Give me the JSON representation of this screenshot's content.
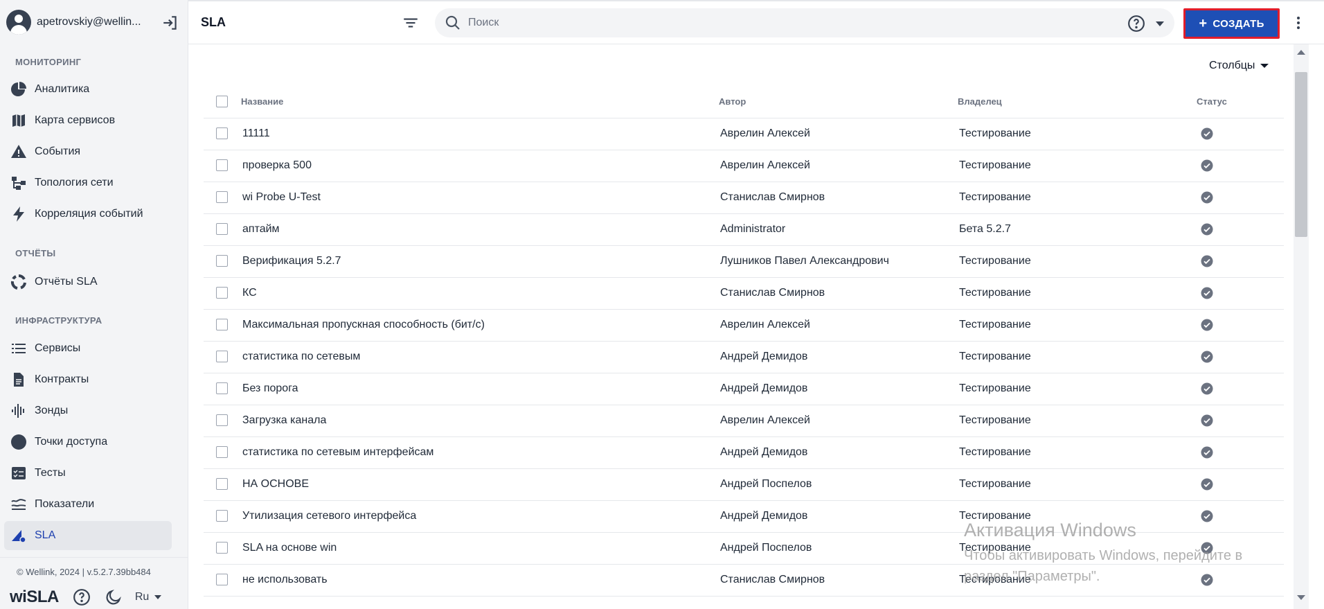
{
  "user": {
    "name": "apetrovskiy@wellin..."
  },
  "sidebar": {
    "sections": [
      {
        "title": "МОНИТОРИНГ"
      },
      {
        "title": "ОТЧЁТЫ"
      },
      {
        "title": "ИНФРАСТРУКТУРА"
      }
    ],
    "items": [
      {
        "label": "Аналитика",
        "icon": "pie-chart-icon"
      },
      {
        "label": "Карта сервисов",
        "icon": "map-icon"
      },
      {
        "label": "События",
        "icon": "warning-icon"
      },
      {
        "label": "Топология сети",
        "icon": "topology-icon"
      },
      {
        "label": "Корреляция событий",
        "icon": "bolt-icon"
      },
      {
        "label": "Отчёты SLA",
        "icon": "report-ring-icon"
      },
      {
        "label": "Сервисы",
        "icon": "list-icon"
      },
      {
        "label": "Контракты",
        "icon": "document-icon"
      },
      {
        "label": "Зонды",
        "icon": "wave-icon"
      },
      {
        "label": "Точки доступа",
        "icon": "circle-icon"
      },
      {
        "label": "Тесты",
        "icon": "checklist-icon"
      },
      {
        "label": "Показатели",
        "icon": "metrics-icon"
      },
      {
        "label": "SLA",
        "icon": "sla-icon",
        "active": true
      }
    ],
    "copyright": "© Wellink, 2024 | v.5.2.7.39bb484",
    "logo": "wiSLA",
    "language": "Ru"
  },
  "header": {
    "title": "SLA",
    "search_placeholder": "Поиск",
    "create_label": "СОЗДАТЬ",
    "create_plus": "+"
  },
  "table": {
    "columns_button": "Столбцы",
    "headers": {
      "name": "Название",
      "author": "Автор",
      "owner": "Владелец",
      "status": "Статус"
    },
    "rows": [
      {
        "name": "11111",
        "author": "Аврелин Алексей",
        "owner": "Тестирование"
      },
      {
        "name": "проверка 500",
        "author": "Аврелин Алексей",
        "owner": "Тестирование"
      },
      {
        "name": "wi Probe U-Test",
        "author": "Станислав Смирнов",
        "owner": "Тестирование"
      },
      {
        "name": "аптайм",
        "author": "Administrator",
        "owner": "Бета 5.2.7"
      },
      {
        "name": "Верификация 5.2.7",
        "author": "Лушников Павел Александрович",
        "owner": "Тестирование"
      },
      {
        "name": "КС",
        "author": "Станислав Смирнов",
        "owner": "Тестирование"
      },
      {
        "name": "Максимальная пропускная способность (бит/с)",
        "author": "Аврелин Алексей",
        "owner": "Тестирование"
      },
      {
        "name": "статистика по сетевым",
        "author": "Андрей Демидов",
        "owner": "Тестирование"
      },
      {
        "name": "Без порога",
        "author": "Андрей Демидов",
        "owner": "Тестирование"
      },
      {
        "name": "Загрузка канала",
        "author": "Аврелин Алексей",
        "owner": "Тестирование"
      },
      {
        "name": "статистика по сетевым интерфейсам",
        "author": "Андрей Демидов",
        "owner": "Тестирование"
      },
      {
        "name": "НА ОСНОВЕ",
        "author": "Андрей Поспелов",
        "owner": "Тестирование"
      },
      {
        "name": "Утилизация сетевого интерфейса",
        "author": "Андрей Демидов",
        "owner": "Тестирование"
      },
      {
        "name": "SLA на основе win",
        "author": "Андрей Поспелов",
        "owner": "Тестирование"
      },
      {
        "name": "не использовать",
        "author": "Станислав Смирнов",
        "owner": "Тестирование"
      }
    ]
  },
  "watermark": {
    "title": "Активация Windows",
    "text": "Чтобы активировать Windows, перейдите в раздел \"Параметры\"."
  },
  "colors": {
    "accent": "#1e4fb5",
    "highlight_border": "#e11d2a",
    "sidebar_bg": "#f3f4f6"
  }
}
